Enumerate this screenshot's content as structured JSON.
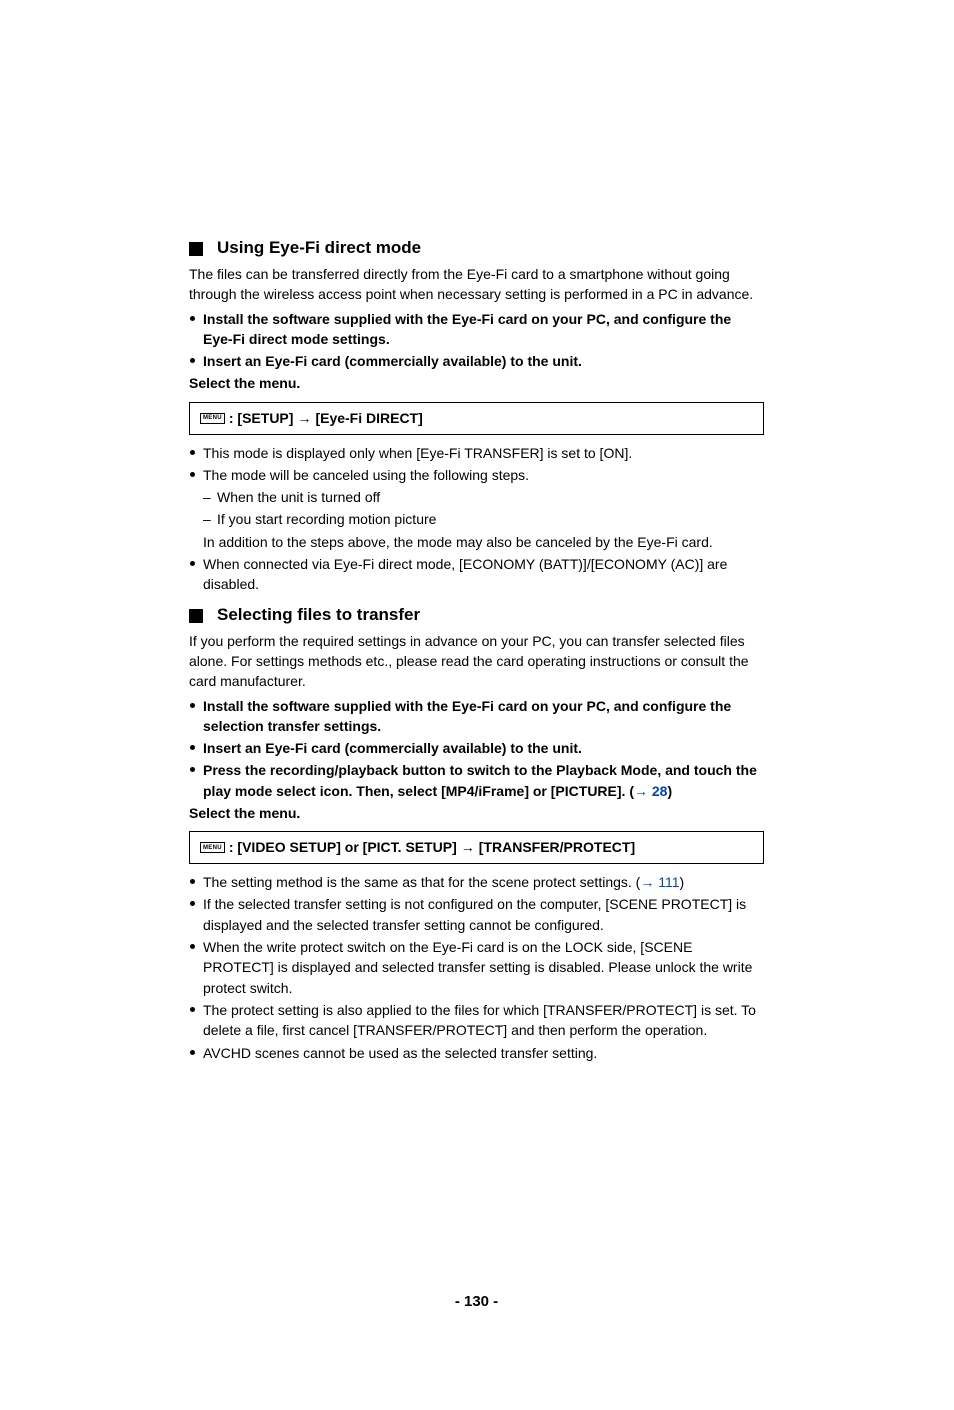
{
  "section1": {
    "heading": "Using Eye-Fi direct mode",
    "intro": "The files can be transferred directly from the Eye-Fi card to a smartphone without going through the wireless access point when necessary setting is performed in a PC in advance.",
    "b1": "Install the software supplied with the Eye-Fi card on your PC, and configure the Eye-Fi direct mode settings.",
    "b2": "Insert an Eye-Fi card (commercially available) to the unit.",
    "select": "Select the menu.",
    "menu_icon": "MENU",
    "menu_colon": ": [SETUP]",
    "menu_arrow": "→",
    "menu_tail": "[Eye-Fi DIRECT]",
    "n1": "This mode is displayed only when [Eye-Fi TRANSFER] is set to [ON].",
    "n2": "The mode will be canceled using the following steps.",
    "n2a": "When the unit is turned off",
    "n2b": "If you start recording motion picture",
    "n2c": "In addition to the steps above, the mode may also be canceled by the Eye-Fi card.",
    "n3": "When connected via Eye-Fi direct mode, [ECONOMY (BATT)]/[ECONOMY (AC)] are disabled."
  },
  "section2": {
    "heading": "Selecting files to transfer",
    "intro": "If you perform the required settings in advance on your PC, you can transfer selected files alone. For settings methods etc., please read the card operating instructions or consult the card manufacturer.",
    "b1": "Install the software supplied with the Eye-Fi card on your PC, and configure the selection transfer settings.",
    "b2": "Insert an Eye-Fi card (commercially available) to the unit.",
    "b3a": "Press the recording/playback button to switch to the Playback Mode, and touch the play mode select icon. Then, select [MP4/iFrame] or [PICTURE]. (",
    "b3_link_arrow": "→ ",
    "b3_link": "28",
    "b3_close": ")",
    "select": "Select the menu.",
    "menu_icon": "MENU",
    "menu_colon": ": [VIDEO SETUP] or [PICT. SETUP]",
    "menu_arrow": "→",
    "menu_tail": "[TRANSFER/PROTECT]",
    "n1a": "The setting method is the same as that for the scene protect settings. (",
    "n1_link_arrow": "→ ",
    "n1_link": "111",
    "n1_close": ")",
    "n2": "If the selected transfer setting is not configured on the computer, [SCENE PROTECT] is displayed and the selected transfer setting cannot be configured.",
    "n3": "When the write protect switch on the Eye-Fi card is on the LOCK side, [SCENE PROTECT] is displayed and selected transfer setting is disabled. Please unlock the write protect switch.",
    "n4": "The protect setting is also applied to the files for which [TRANSFER/PROTECT] is set. To delete a file, first cancel [TRANSFER/PROTECT] and then perform the operation.",
    "n5": "AVCHD scenes cannot be used as the selected transfer setting."
  },
  "page_number": "- 130 -"
}
